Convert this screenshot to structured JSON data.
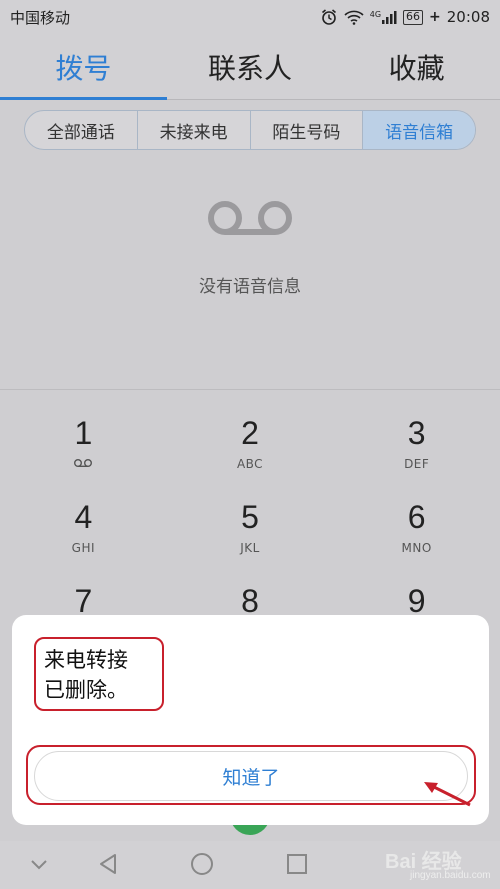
{
  "status": {
    "carrier": "中国移动",
    "network": "4G",
    "battery": "66",
    "time": "20:08",
    "charge_symbol": "+"
  },
  "tabs": [
    {
      "label": "拨号",
      "active": true
    },
    {
      "label": "联系人",
      "active": false
    },
    {
      "label": "收藏",
      "active": false
    }
  ],
  "filters": [
    {
      "label": "全部通话",
      "active": false
    },
    {
      "label": "未接来电",
      "active": false
    },
    {
      "label": "陌生号码",
      "active": false
    },
    {
      "label": "语音信箱",
      "active": true
    }
  ],
  "voicemail": {
    "empty_text": "没有语音信息",
    "icon": "voicemail-icon"
  },
  "keypad": [
    [
      {
        "digit": "1",
        "sub": ""
      },
      {
        "digit": "2",
        "sub": "ABC"
      },
      {
        "digit": "3",
        "sub": "DEF"
      }
    ],
    [
      {
        "digit": "4",
        "sub": "GHI"
      },
      {
        "digit": "5",
        "sub": "JKL"
      },
      {
        "digit": "6",
        "sub": "MNO"
      }
    ],
    [
      {
        "digit": "7",
        "sub": ""
      },
      {
        "digit": "8",
        "sub": ""
      },
      {
        "digit": "9",
        "sub": ""
      }
    ]
  ],
  "dialog": {
    "message_line1": "来电转接",
    "message_line2": "已删除。",
    "button_label": "知道了"
  },
  "navbar": {
    "icons": [
      "chevron-down-icon",
      "back-icon",
      "home-icon",
      "recents-icon"
    ]
  },
  "watermark": {
    "text": "Bai 经验",
    "sub": "jingyan.baidu.com"
  },
  "colors": {
    "accent": "#2f7fd3",
    "highlight": "#c8202c"
  }
}
